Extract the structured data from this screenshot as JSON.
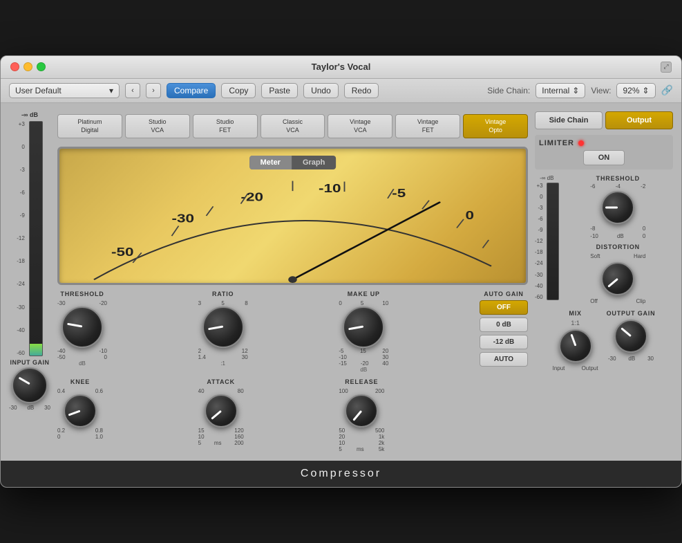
{
  "window": {
    "title": "Taylor's Vocal"
  },
  "toolbar": {
    "preset": "User Default",
    "compare": "Compare",
    "copy": "Copy",
    "paste": "Paste",
    "undo": "Undo",
    "redo": "Redo",
    "sidechain_label": "Side Chain:",
    "sidechain_value": "Internal",
    "view_label": "View:",
    "view_value": "92%"
  },
  "models": [
    {
      "id": "platinum-digital",
      "label": "Platinum\nDigital"
    },
    {
      "id": "studio-vca",
      "label": "Studio\nVCA"
    },
    {
      "id": "studio-fet",
      "label": "Studio\nFET"
    },
    {
      "id": "classic-vca",
      "label": "Classic\nVCA"
    },
    {
      "id": "vintage-vca",
      "label": "Vintage\nVCA"
    },
    {
      "id": "vintage-fet",
      "label": "Vintage\nFET"
    },
    {
      "id": "vintage-opto",
      "label": "Vintage\nOpto"
    }
  ],
  "display": {
    "meter_tab": "Meter",
    "graph_tab": "Graph",
    "scale": [
      "-50",
      "-30",
      "-20",
      "-10",
      "-5",
      "0"
    ]
  },
  "controls": {
    "threshold_label": "THRESHOLD",
    "threshold_range": [
      "-50",
      "0"
    ],
    "threshold_db": "dB",
    "ratio_label": "RATIO",
    "ratio_range": [
      "1.4",
      "30"
    ],
    "ratio_unit": ":1",
    "makeup_label": "MAKE UP",
    "makeup_range": [
      "-20",
      "40"
    ],
    "makeup_db": "dB",
    "auto_gain_label": "AUTO GAIN",
    "auto_gain_off": "OFF",
    "auto_gain_0db": "0 dB",
    "auto_gain_12db": "-12 dB",
    "auto_btn": "AUTO",
    "knee_label": "KNEE",
    "knee_range": [
      "0",
      "1.0"
    ],
    "attack_label": "ATTACK",
    "attack_range": [
      "5",
      "200"
    ],
    "attack_unit": "ms",
    "release_label": "RELEASE",
    "release_range": [
      "5",
      "5k"
    ],
    "release_unit": "ms"
  },
  "right_panel": {
    "sidechain_btn": "Side Chain",
    "output_btn": "Output",
    "limiter_label": "LIMITER",
    "limiter_on": "ON",
    "threshold_label": "THRESHOLD",
    "threshold_range_top": [
      "-6",
      "0"
    ],
    "threshold_range_bot": [
      "-10",
      "0"
    ],
    "threshold_db": "dB",
    "distortion_label": "DISTORTION",
    "dist_soft": "Soft",
    "dist_hard": "Hard",
    "dist_off": "Off",
    "dist_clip": "Clip",
    "mix_label": "MIX",
    "mix_value": "1:1",
    "mix_input": "Input",
    "mix_output": "Output",
    "output_gain_label": "OUTPUT GAIN",
    "output_gain_range": [
      "-30",
      "30"
    ],
    "output_gain_db": "dB"
  },
  "input_gain": {
    "label": "INPUT GAIN",
    "range": [
      "-30",
      "30"
    ],
    "db": "dB",
    "vu_labels": [
      "+3",
      "0",
      "-3",
      "-6",
      "-9",
      "-12",
      "-18",
      "-24",
      "-30",
      "-40",
      "-60"
    ],
    "top_label": "-∞ dB"
  },
  "right_vu": {
    "top_label": "-∞ dB",
    "labels": [
      "+3",
      "0",
      "-3",
      "-6",
      "-9",
      "-12",
      "-18",
      "-24",
      "-30",
      "-40",
      "-60"
    ]
  },
  "bottom": {
    "label": "Compressor"
  }
}
